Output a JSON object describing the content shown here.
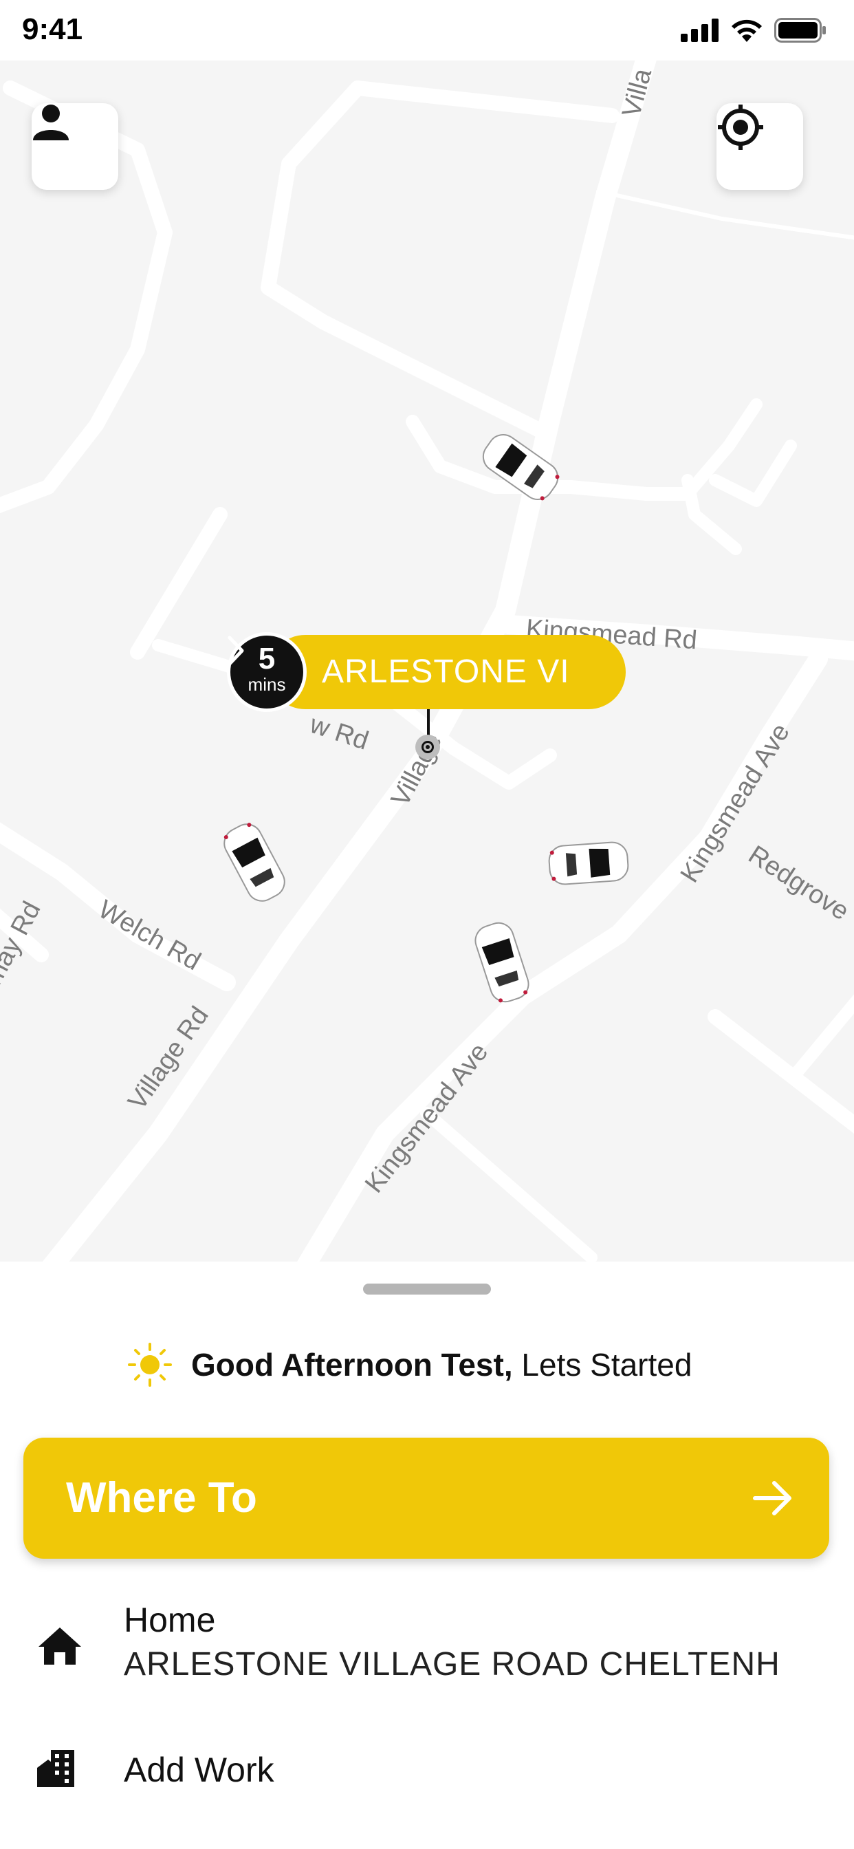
{
  "status_bar": {
    "time": "9:41"
  },
  "map": {
    "streets": {
      "village_rd_top": "Villa",
      "kingsmead_rd": "Kingsmead Rd",
      "w_rd": "w Rd",
      "village_mid": "Village",
      "kingsmead_ave_right": "Kingsmead Ave",
      "redgrove": "Redgrove",
      "welch_rd": "Welch Rd",
      "may_rd": "may Rd",
      "village_rd_bottom": "Village Rd",
      "kingsmead_ave_bottom": "Kingsmead Ave"
    },
    "pickup": {
      "eta_value": "5",
      "eta_unit": "mins",
      "label": "ARLESTONE VI"
    }
  },
  "sheet": {
    "greeting_bold": "Good Afternoon Test,",
    "greeting_rest": " Lets Started",
    "where_to_label": "Where To",
    "places": [
      {
        "icon": "home-icon",
        "title": "Home",
        "address": "ARLESTONE VILLAGE ROAD CHELTENH"
      },
      {
        "icon": "office-building-icon",
        "title": "Add Work"
      }
    ]
  },
  "colors": {
    "accent": "#f0c808",
    "map_bg": "#f5f5f5",
    "road": "#ffffff",
    "text": "#111111"
  }
}
